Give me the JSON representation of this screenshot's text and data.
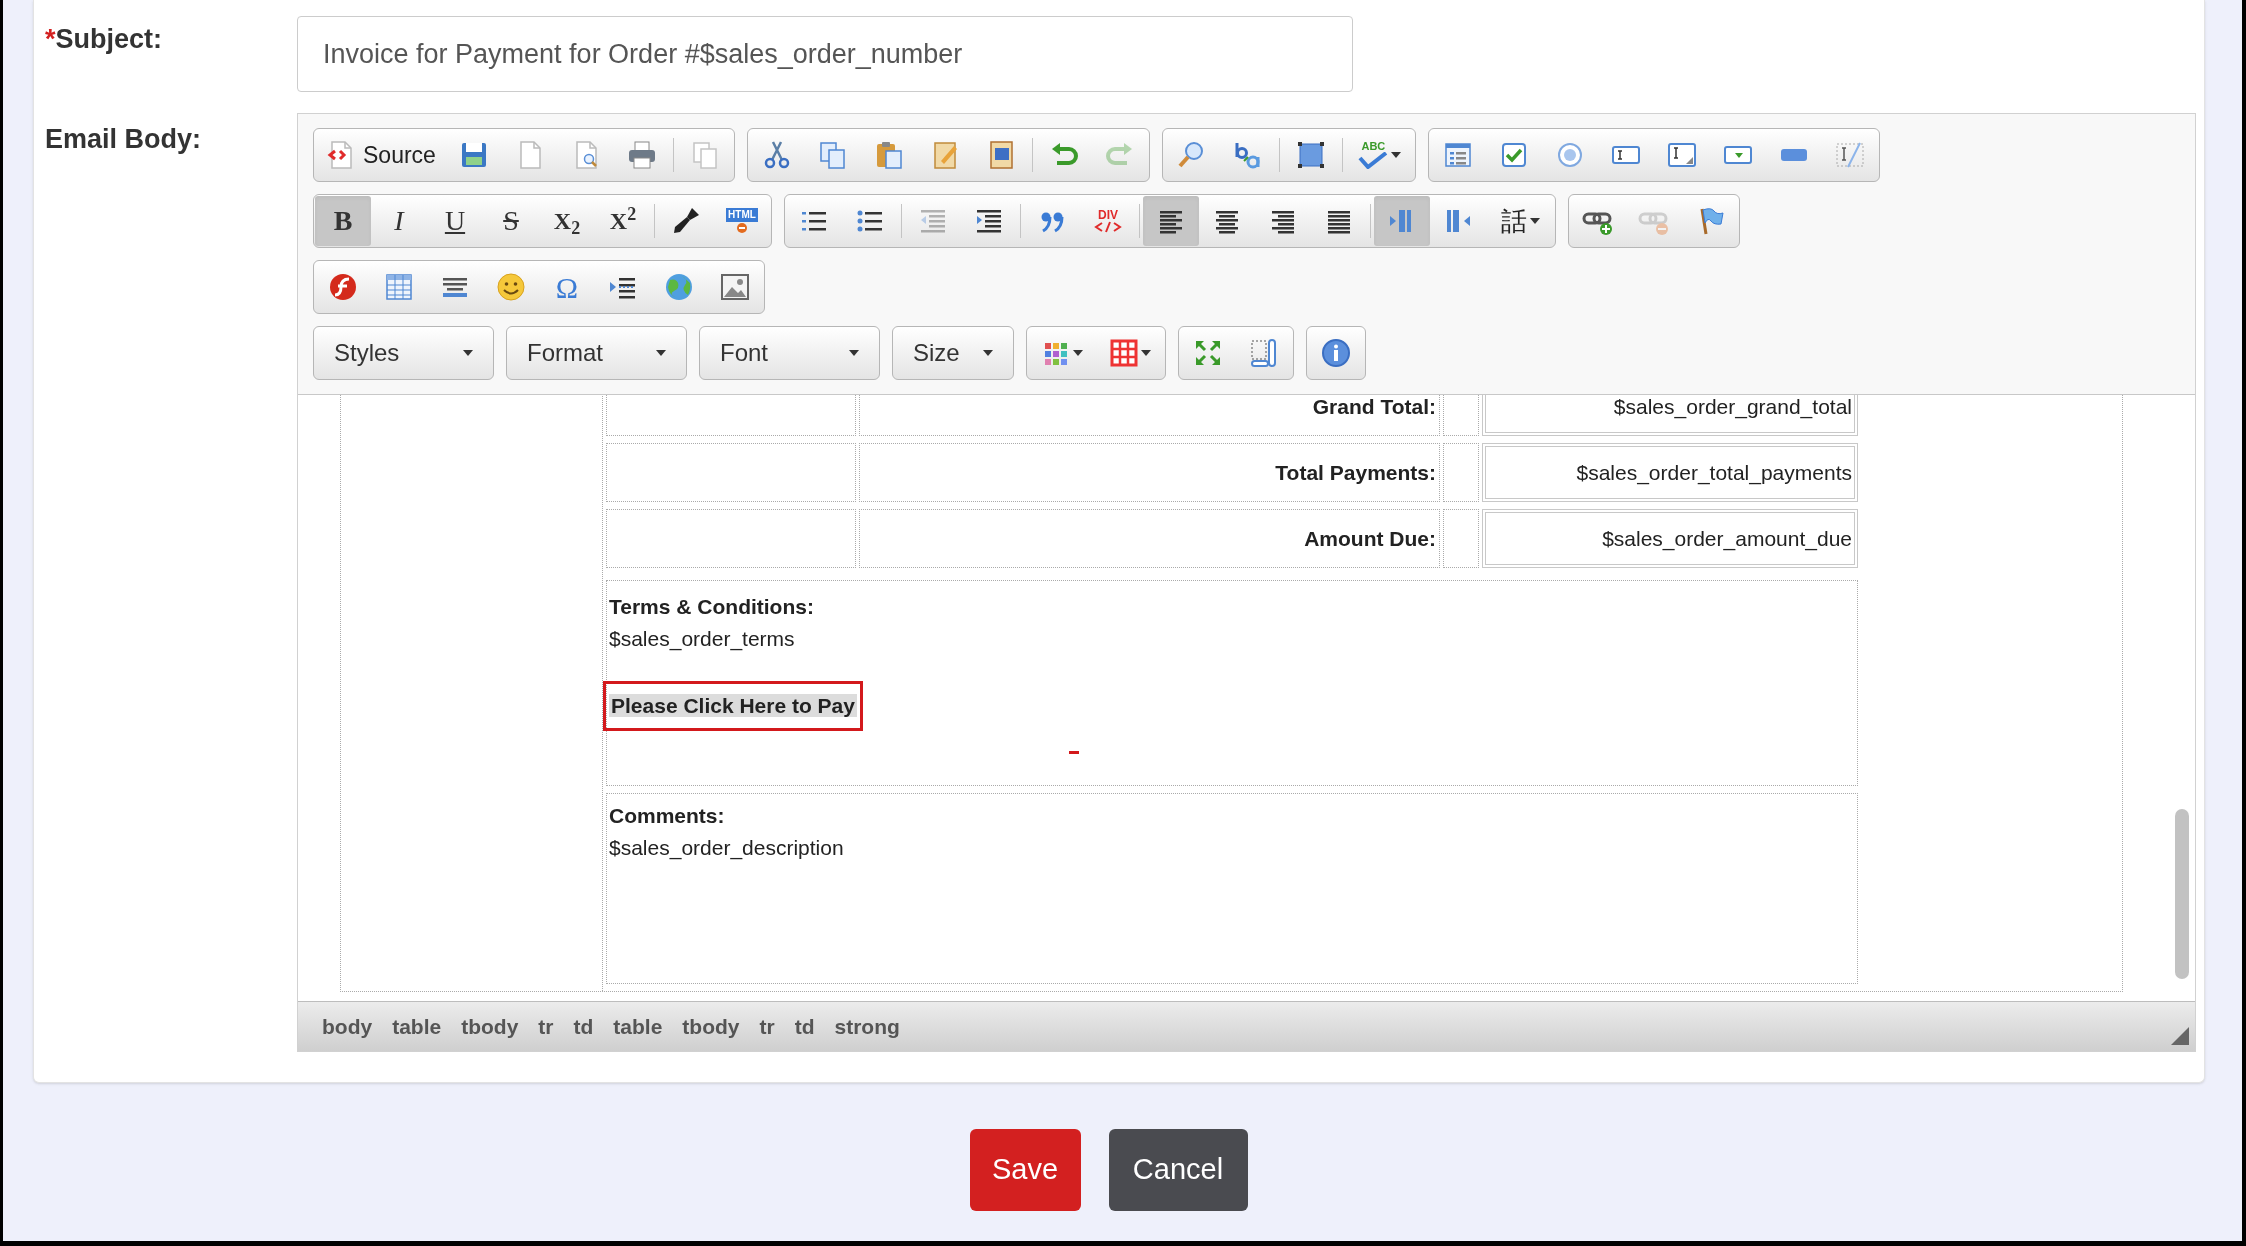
{
  "subject": {
    "required_mark": "*",
    "label": "Subject:",
    "value": "Invoice for Payment for Order #$sales_order_number"
  },
  "email_body": {
    "label": "Email Body:"
  },
  "toolbar": {
    "rows": [
      {
        "items": [
          {
            "kind": "group",
            "sections": [
              {
                "buttons": [
                  {
                    "kind": "source",
                    "label": "Source",
                    "selected": false,
                    "disabled": false
                  },
                  {
                    "kind": "save",
                    "selected": false,
                    "disabled": false
                  },
                  {
                    "kind": "newpage",
                    "selected": false,
                    "disabled": false
                  },
                  {
                    "kind": "preview",
                    "selected": false,
                    "disabled": false
                  },
                  {
                    "kind": "print",
                    "selected": false,
                    "disabled": false
                  }
                ]
              },
              {
                "buttons": [
                  {
                    "kind": "templates",
                    "selected": false,
                    "disabled": false
                  }
                ]
              }
            ]
          },
          {
            "kind": "group",
            "sections": [
              {
                "buttons": [
                  {
                    "kind": "cut",
                    "selected": false,
                    "disabled": false
                  },
                  {
                    "kind": "copy",
                    "selected": false,
                    "disabled": false
                  },
                  {
                    "kind": "paste",
                    "selected": false,
                    "disabled": false
                  },
                  {
                    "kind": "pastetext",
                    "selected": false,
                    "disabled": false
                  },
                  {
                    "kind": "pasteword",
                    "selected": false,
                    "disabled": false
                  }
                ]
              },
              {
                "buttons": [
                  {
                    "kind": "undo",
                    "selected": false,
                    "disabled": false
                  },
                  {
                    "kind": "redo",
                    "selected": false,
                    "disabled": true
                  }
                ]
              }
            ]
          },
          {
            "kind": "group",
            "sections": [
              {
                "buttons": [
                  {
                    "kind": "find",
                    "selected": false,
                    "disabled": false
                  },
                  {
                    "kind": "replace",
                    "selected": false,
                    "disabled": false
                  }
                ]
              },
              {
                "buttons": [
                  {
                    "kind": "selectall",
                    "selected": false,
                    "disabled": false
                  }
                ]
              },
              {
                "buttons": [
                  {
                    "kind": "spellcheck",
                    "label": "ABC",
                    "selected": false,
                    "disabled": false
                  }
                ]
              }
            ]
          },
          {
            "kind": "group",
            "sections": [
              {
                "buttons": [
                  {
                    "kind": "form",
                    "selected": false,
                    "disabled": false
                  },
                  {
                    "kind": "checkbox",
                    "selected": false,
                    "disabled": false
                  },
                  {
                    "kind": "radio",
                    "selected": false,
                    "disabled": false
                  },
                  {
                    "kind": "textfield",
                    "selected": false,
                    "disabled": false
                  },
                  {
                    "kind": "textarea",
                    "selected": false,
                    "disabled": false
                  },
                  {
                    "kind": "select",
                    "selected": false,
                    "disabled": false
                  },
                  {
                    "kind": "formbutton",
                    "selected": false,
                    "disabled": false
                  },
                  {
                    "kind": "hiddenfield",
                    "selected": false,
                    "disabled": false
                  }
                ]
              }
            ]
          }
        ]
      },
      {
        "items": [
          {
            "kind": "group",
            "sections": [
              {
                "buttons": [
                  {
                    "kind": "bold",
                    "label": "B",
                    "selected": true,
                    "disabled": false
                  },
                  {
                    "kind": "italic",
                    "label": "I",
                    "selected": false,
                    "disabled": false
                  },
                  {
                    "kind": "underline",
                    "label": "U",
                    "selected": false,
                    "disabled": false
                  },
                  {
                    "kind": "strike",
                    "label": "S",
                    "selected": false,
                    "disabled": false
                  },
                  {
                    "kind": "subscript",
                    "label": "X$_{2}$",
                    "selected": false,
                    "disabled": false
                  },
                  {
                    "kind": "superscript",
                    "label": "X$^{2}$",
                    "selected": false,
                    "disabled": false
                  }
                ]
              },
              {
                "buttons": [
                  {
                    "kind": "copyformat",
                    "selected": false,
                    "disabled": false
                  },
                  {
                    "kind": "removeformat",
                    "label": "HTML",
                    "selected": false,
                    "disabled": false
                  }
                ]
              }
            ]
          },
          {
            "kind": "group",
            "sections": [
              {
                "buttons": [
                  {
                    "kind": "numlist",
                    "selected": false,
                    "disabled": false
                  },
                  {
                    "kind": "bulllist",
                    "selected": false,
                    "disabled": false
                  }
                ]
              },
              {
                "buttons": [
                  {
                    "kind": "outdent",
                    "selected": false,
                    "disabled": true
                  },
                  {
                    "kind": "indent",
                    "selected": false,
                    "disabled": false
                  }
                ]
              },
              {
                "buttons": [
                  {
                    "kind": "blockquote",
                    "selected": false,
                    "disabled": false
                  },
                  {
                    "kind": "creatediv",
                    "label": "DIV",
                    "selected": false,
                    "disabled": false
                  }
                ]
              },
              {
                "buttons": [
                  {
                    "kind": "alignleft",
                    "selected": true,
                    "disabled": false
                  },
                  {
                    "kind": "aligncenter",
                    "selected": false,
                    "disabled": false
                  },
                  {
                    "kind": "alignright",
                    "selected": false,
                    "disabled": false
                  },
                  {
                    "kind": "justify",
                    "selected": false,
                    "disabled": false
                  }
                ]
              },
              {
                "buttons": [
                  {
                    "kind": "ltr",
                    "selected": true,
                    "disabled": false
                  },
                  {
                    "kind": "rtl",
                    "selected": false,
                    "disabled": false
                  },
                  {
                    "kind": "language",
                    "label": "話",
                    "selected": false,
                    "disabled": false
                  }
                ]
              }
            ]
          },
          {
            "kind": "group",
            "sections": [
              {
                "buttons": [
                  {
                    "kind": "link",
                    "selected": false,
                    "disabled": false
                  },
                  {
                    "kind": "unlink",
                    "selected": false,
                    "disabled": true
                  },
                  {
                    "kind": "anchor",
                    "selected": false,
                    "disabled": false
                  }
                ]
              }
            ]
          }
        ]
      },
      {
        "items": [
          {
            "kind": "group",
            "sections": [
              {
                "buttons": [
                  {
                    "kind": "flash",
                    "selected": false,
                    "disabled": false
                  },
                  {
                    "kind": "table",
                    "selected": false,
                    "disabled": false
                  },
                  {
                    "kind": "hr",
                    "selected": false,
                    "disabled": false
                  },
                  {
                    "kind": "smiley",
                    "selected": false,
                    "disabled": false
                  },
                  {
                    "kind": "specialchar",
                    "label": "Ω",
                    "selected": false,
                    "disabled": false
                  },
                  {
                    "kind": "pagebreak",
                    "selected": false,
                    "disabled": false
                  },
                  {
                    "kind": "iframe",
                    "selected": false,
                    "disabled": false
                  },
                  {
                    "kind": "image",
                    "selected": false,
                    "disabled": false
                  }
                ]
              }
            ]
          }
        ]
      },
      {
        "items": [
          {
            "kind": "combo",
            "label": "Styles"
          },
          {
            "kind": "combo",
            "label": "Format"
          },
          {
            "kind": "combo",
            "label": "Font"
          },
          {
            "kind": "combo",
            "label": "Size"
          },
          {
            "kind": "group",
            "sections": [
              {
                "buttons": [
                  {
                    "kind": "textcolor",
                    "selected": false,
                    "disabled": false
                  },
                  {
                    "kind": "bgcolor",
                    "selected": false,
                    "disabled": false
                  }
                ]
              }
            ]
          },
          {
            "kind": "group",
            "sections": [
              {
                "buttons": [
                  {
                    "kind": "maximize",
                    "selected": false,
                    "disabled": false
                  },
                  {
                    "kind": "showblocks",
                    "selected": false,
                    "disabled": false
                  }
                ]
              }
            ]
          },
          {
            "kind": "group",
            "sections": [
              {
                "buttons": [
                  {
                    "kind": "about",
                    "selected": false,
                    "disabled": false
                  }
                ]
              }
            ]
          }
        ]
      }
    ]
  },
  "document": {
    "summary_rows": [
      {
        "label": "Grand Total:",
        "value": "$sales_order_grand_total"
      },
      {
        "label": "Total Payments:",
        "value": "$sales_order_total_payments"
      },
      {
        "label": "Amount Due:",
        "value": "$sales_order_amount_due"
      }
    ],
    "terms": {
      "heading": "Terms & Conditions:",
      "text": "$sales_order_terms",
      "pay_link": "Please Click Here to Pay",
      "outlined": true
    },
    "comments": {
      "heading": "Comments:",
      "text": "$sales_order_description"
    }
  },
  "status_path": [
    "body",
    "table",
    "tbody",
    "tr",
    "td",
    "table",
    "tbody",
    "tr",
    "td",
    "strong"
  ],
  "buttons": [
    {
      "kind": "primary",
      "label": "Save"
    },
    {
      "kind": "secondary",
      "label": "Cancel"
    }
  ]
}
